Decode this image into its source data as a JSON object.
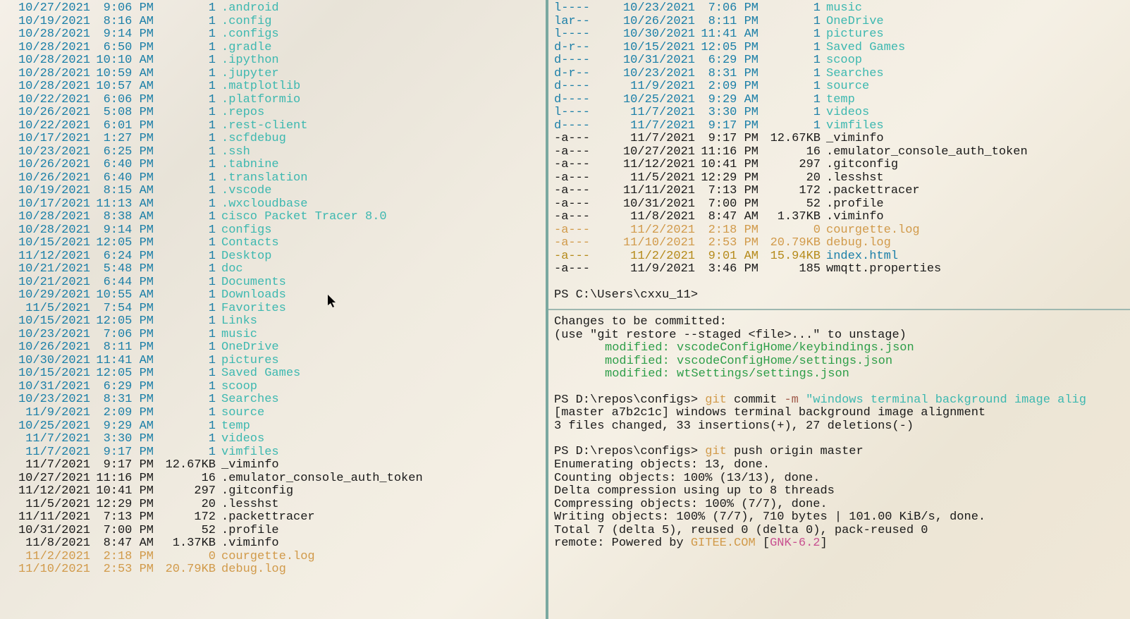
{
  "left_listing": [
    {
      "date": "10/27/2021",
      "time": "9:06 PM",
      "size": "1",
      "name": ".android",
      "kind": "dir"
    },
    {
      "date": "10/19/2021",
      "time": "8:16 AM",
      "size": "1",
      "name": ".config",
      "kind": "dir"
    },
    {
      "date": "10/28/2021",
      "time": "9:14 PM",
      "size": "1",
      "name": ".configs",
      "kind": "dir"
    },
    {
      "date": "10/28/2021",
      "time": "6:50 PM",
      "size": "1",
      "name": ".gradle",
      "kind": "dir"
    },
    {
      "date": "10/28/2021",
      "time": "10:10 AM",
      "size": "1",
      "name": ".ipython",
      "kind": "dir"
    },
    {
      "date": "10/28/2021",
      "time": "10:59 AM",
      "size": "1",
      "name": ".jupyter",
      "kind": "dir"
    },
    {
      "date": "10/28/2021",
      "time": "10:57 AM",
      "size": "1",
      "name": ".matplotlib",
      "kind": "dir"
    },
    {
      "date": "10/22/2021",
      "time": "6:06 PM",
      "size": "1",
      "name": ".platformio",
      "kind": "dir"
    },
    {
      "date": "10/26/2021",
      "time": "5:08 PM",
      "size": "1",
      "name": ".repos",
      "kind": "dir"
    },
    {
      "date": "10/22/2021",
      "time": "6:01 PM",
      "size": "1",
      "name": ".rest-client",
      "kind": "dir"
    },
    {
      "date": "10/17/2021",
      "time": "1:27 PM",
      "size": "1",
      "name": ".scfdebug",
      "kind": "dir"
    },
    {
      "date": "10/23/2021",
      "time": "6:25 PM",
      "size": "1",
      "name": ".ssh",
      "kind": "dir"
    },
    {
      "date": "10/26/2021",
      "time": "6:40 PM",
      "size": "1",
      "name": ".tabnine",
      "kind": "dir"
    },
    {
      "date": "10/26/2021",
      "time": "6:40 PM",
      "size": "1",
      "name": ".translation",
      "kind": "dir"
    },
    {
      "date": "10/19/2021",
      "time": "8:15 AM",
      "size": "1",
      "name": ".vscode",
      "kind": "dir"
    },
    {
      "date": "10/17/2021",
      "time": "11:13 AM",
      "size": "1",
      "name": ".wxcloudbase",
      "kind": "dir"
    },
    {
      "date": "10/28/2021",
      "time": "8:38 AM",
      "size": "1",
      "name": "cisco Packet Tracer 8.0",
      "kind": "dir"
    },
    {
      "date": "10/28/2021",
      "time": "9:14 PM",
      "size": "1",
      "name": "configs",
      "kind": "dir"
    },
    {
      "date": "10/15/2021",
      "time": "12:05 PM",
      "size": "1",
      "name": "Contacts",
      "kind": "dir"
    },
    {
      "date": "11/12/2021",
      "time": "6:24 PM",
      "size": "1",
      "name": "Desktop",
      "kind": "dir"
    },
    {
      "date": "10/21/2021",
      "time": "5:48 PM",
      "size": "1",
      "name": "doc",
      "kind": "dir"
    },
    {
      "date": "10/21/2021",
      "time": "6:44 PM",
      "size": "1",
      "name": "Documents",
      "kind": "dir"
    },
    {
      "date": "10/29/2021",
      "time": "10:55 AM",
      "size": "1",
      "name": "Downloads",
      "kind": "dir"
    },
    {
      "date": "11/5/2021",
      "time": "7:54 PM",
      "size": "1",
      "name": "Favorites",
      "kind": "dir"
    },
    {
      "date": "10/15/2021",
      "time": "12:05 PM",
      "size": "1",
      "name": "Links",
      "kind": "dir"
    },
    {
      "date": "10/23/2021",
      "time": "7:06 PM",
      "size": "1",
      "name": "music",
      "kind": "dir"
    },
    {
      "date": "10/26/2021",
      "time": "8:11 PM",
      "size": "1",
      "name": "OneDrive",
      "kind": "dir"
    },
    {
      "date": "10/30/2021",
      "time": "11:41 AM",
      "size": "1",
      "name": "pictures",
      "kind": "dir"
    },
    {
      "date": "10/15/2021",
      "time": "12:05 PM",
      "size": "1",
      "name": "Saved Games",
      "kind": "dir"
    },
    {
      "date": "10/31/2021",
      "time": "6:29 PM",
      "size": "1",
      "name": "scoop",
      "kind": "dir"
    },
    {
      "date": "10/23/2021",
      "time": "8:31 PM",
      "size": "1",
      "name": "Searches",
      "kind": "dir"
    },
    {
      "date": "11/9/2021",
      "time": "2:09 PM",
      "size": "1",
      "name": "source",
      "kind": "dir"
    },
    {
      "date": "10/25/2021",
      "time": "9:29 AM",
      "size": "1",
      "name": "temp",
      "kind": "dir"
    },
    {
      "date": "11/7/2021",
      "time": "3:30 PM",
      "size": "1",
      "name": "videos",
      "kind": "dir"
    },
    {
      "date": "11/7/2021",
      "time": "9:17 PM",
      "size": "1",
      "name": "vimfiles",
      "kind": "dir"
    },
    {
      "date": "11/7/2021",
      "time": "9:17 PM",
      "size": "12.67KB",
      "name": "_viminfo",
      "kind": "file"
    },
    {
      "date": "10/27/2021",
      "time": "11:16 PM",
      "size": "16",
      "name": ".emulator_console_auth_token",
      "kind": "file"
    },
    {
      "date": "11/12/2021",
      "time": "10:41 PM",
      "size": "297",
      "name": ".gitconfig",
      "kind": "file"
    },
    {
      "date": "11/5/2021",
      "time": "12:29 PM",
      "size": "20",
      "name": ".lesshst",
      "kind": "file"
    },
    {
      "date": "11/11/2021",
      "time": "7:13 PM",
      "size": "172",
      "name": ".packettracer",
      "kind": "file"
    },
    {
      "date": "10/31/2021",
      "time": "7:00 PM",
      "size": "52",
      "name": ".profile",
      "kind": "file"
    },
    {
      "date": "11/8/2021",
      "time": "8:47 AM",
      "size": "1.37KB",
      "name": ".viminfo",
      "kind": "file"
    },
    {
      "date": "11/2/2021",
      "time": "2:18 PM",
      "size": "0",
      "name": "courgette.log",
      "kind": "log"
    },
    {
      "date": "11/10/2021",
      "time": "2:53 PM",
      "size": "20.79KB",
      "name": "debug.log",
      "kind": "log"
    }
  ],
  "right_listing": [
    {
      "mode": "l----",
      "date": "10/23/2021",
      "time": "7:06 PM",
      "size": "1",
      "name": "music",
      "kind": "dir"
    },
    {
      "mode": "lar--",
      "date": "10/26/2021",
      "time": "8:11 PM",
      "size": "1",
      "name": "OneDrive",
      "kind": "dir"
    },
    {
      "mode": "l----",
      "date": "10/30/2021",
      "time": "11:41 AM",
      "size": "1",
      "name": "pictures",
      "kind": "dir"
    },
    {
      "mode": "d-r--",
      "date": "10/15/2021",
      "time": "12:05 PM",
      "size": "1",
      "name": "Saved Games",
      "kind": "dir"
    },
    {
      "mode": "d----",
      "date": "10/31/2021",
      "time": "6:29 PM",
      "size": "1",
      "name": "scoop",
      "kind": "dir"
    },
    {
      "mode": "d-r--",
      "date": "10/23/2021",
      "time": "8:31 PM",
      "size": "1",
      "name": "Searches",
      "kind": "dir"
    },
    {
      "mode": "d----",
      "date": "11/9/2021",
      "time": "2:09 PM",
      "size": "1",
      "name": "source",
      "kind": "dir"
    },
    {
      "mode": "d----",
      "date": "10/25/2021",
      "time": "9:29 AM",
      "size": "1",
      "name": "temp",
      "kind": "dir"
    },
    {
      "mode": "l----",
      "date": "11/7/2021",
      "time": "3:30 PM",
      "size": "1",
      "name": "videos",
      "kind": "dir"
    },
    {
      "mode": "d----",
      "date": "11/7/2021",
      "time": "9:17 PM",
      "size": "1",
      "name": "vimfiles",
      "kind": "dir"
    },
    {
      "mode": "-a---",
      "date": "11/7/2021",
      "time": "9:17 PM",
      "size": "12.67KB",
      "name": "_viminfo",
      "kind": "file"
    },
    {
      "mode": "-a---",
      "date": "10/27/2021",
      "time": "11:16 PM",
      "size": "16",
      "name": ".emulator_console_auth_token",
      "kind": "file"
    },
    {
      "mode": "-a---",
      "date": "11/12/2021",
      "time": "10:41 PM",
      "size": "297",
      "name": ".gitconfig",
      "kind": "file"
    },
    {
      "mode": "-a---",
      "date": "11/5/2021",
      "time": "12:29 PM",
      "size": "20",
      "name": ".lesshst",
      "kind": "file"
    },
    {
      "mode": "-a---",
      "date": "11/11/2021",
      "time": "7:13 PM",
      "size": "172",
      "name": ".packettracer",
      "kind": "file"
    },
    {
      "mode": "-a---",
      "date": "10/31/2021",
      "time": "7:00 PM",
      "size": "52",
      "name": ".profile",
      "kind": "file"
    },
    {
      "mode": "-a---",
      "date": "11/8/2021",
      "time": "8:47 AM",
      "size": "1.37KB",
      "name": ".viminfo",
      "kind": "file"
    },
    {
      "mode": "-a---",
      "date": "11/2/2021",
      "time": "2:18 PM",
      "size": "0",
      "name": "courgette.log",
      "kind": "log"
    },
    {
      "mode": "-a---",
      "date": "11/10/2021",
      "time": "2:53 PM",
      "size": "20.79KB",
      "name": "debug.log",
      "kind": "log"
    },
    {
      "mode": "-a---",
      "date": "11/2/2021",
      "time": "9:01 AM",
      "size": "15.94KB",
      "name": "index.html",
      "kind": "html"
    },
    {
      "mode": "-a---",
      "date": "11/9/2021",
      "time": "3:46 PM",
      "size": "185",
      "name": "wmqtt.properties",
      "kind": "file"
    }
  ],
  "right_prompt": "PS C:\\Users\\cxxu_11>",
  "git_status": {
    "header": "Changes to be committed:",
    "hint": "  (use \"git restore --staged <file>...\" to unstage)",
    "mod_label": "modified:",
    "files": [
      "vscodeConfigHome/keybindings.json",
      "vscodeConfigHome/settings.json",
      "wtSettings/settings.json"
    ]
  },
  "git_commit": {
    "prompt_prefix": "PS D:\\repos\\configs> ",
    "cmd": "git",
    "args_prefix": " commit ",
    "flag": "-m",
    "msg": " \"windows terminal background image alig",
    "out1": "[master a7b2c1c] windows terminal background image alignment",
    "out2": " 3 files changed, 33 insertions(+), 27 deletions(-)"
  },
  "git_push": {
    "prompt_prefix": "PS D:\\repos\\configs> ",
    "cmd": "git",
    "args": " push origin master",
    "lines": [
      "Enumerating objects: 13, done.",
      "Counting objects: 100% (13/13), done.",
      "Delta compression using up to 8 threads",
      "Compressing objects: 100% (7/7), done.",
      "Writing objects: 100% (7/7), 710 bytes | 101.00 KiB/s, done.",
      "Total 7 (delta 5), reused 0 (delta 0), pack-reused 0"
    ],
    "remote_prefix": "remote: Powered by ",
    "remote_host": "GITEE.COM",
    "remote_bracket_open": " [",
    "remote_version": "GNK-6.2",
    "remote_bracket_close": "]"
  }
}
